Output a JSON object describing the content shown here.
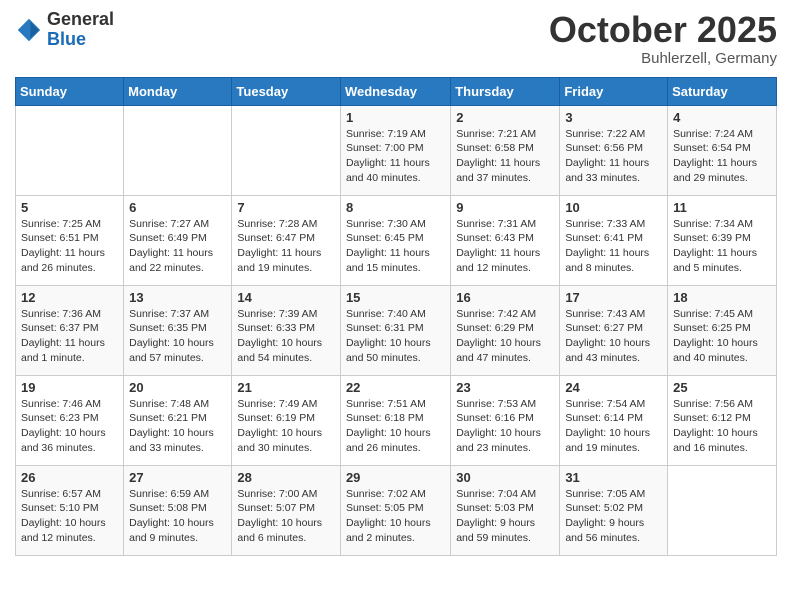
{
  "header": {
    "logo_general": "General",
    "logo_blue": "Blue",
    "month": "October 2025",
    "location": "Buhlerzell, Germany"
  },
  "days_of_week": [
    "Sunday",
    "Monday",
    "Tuesday",
    "Wednesday",
    "Thursday",
    "Friday",
    "Saturday"
  ],
  "weeks": [
    [
      {
        "day": "",
        "info": ""
      },
      {
        "day": "",
        "info": ""
      },
      {
        "day": "",
        "info": ""
      },
      {
        "day": "1",
        "info": "Sunrise: 7:19 AM\nSunset: 7:00 PM\nDaylight: 11 hours and 40 minutes."
      },
      {
        "day": "2",
        "info": "Sunrise: 7:21 AM\nSunset: 6:58 PM\nDaylight: 11 hours and 37 minutes."
      },
      {
        "day": "3",
        "info": "Sunrise: 7:22 AM\nSunset: 6:56 PM\nDaylight: 11 hours and 33 minutes."
      },
      {
        "day": "4",
        "info": "Sunrise: 7:24 AM\nSunset: 6:54 PM\nDaylight: 11 hours and 29 minutes."
      }
    ],
    [
      {
        "day": "5",
        "info": "Sunrise: 7:25 AM\nSunset: 6:51 PM\nDaylight: 11 hours and 26 minutes."
      },
      {
        "day": "6",
        "info": "Sunrise: 7:27 AM\nSunset: 6:49 PM\nDaylight: 11 hours and 22 minutes."
      },
      {
        "day": "7",
        "info": "Sunrise: 7:28 AM\nSunset: 6:47 PM\nDaylight: 11 hours and 19 minutes."
      },
      {
        "day": "8",
        "info": "Sunrise: 7:30 AM\nSunset: 6:45 PM\nDaylight: 11 hours and 15 minutes."
      },
      {
        "day": "9",
        "info": "Sunrise: 7:31 AM\nSunset: 6:43 PM\nDaylight: 11 hours and 12 minutes."
      },
      {
        "day": "10",
        "info": "Sunrise: 7:33 AM\nSunset: 6:41 PM\nDaylight: 11 hours and 8 minutes."
      },
      {
        "day": "11",
        "info": "Sunrise: 7:34 AM\nSunset: 6:39 PM\nDaylight: 11 hours and 5 minutes."
      }
    ],
    [
      {
        "day": "12",
        "info": "Sunrise: 7:36 AM\nSunset: 6:37 PM\nDaylight: 11 hours and 1 minute."
      },
      {
        "day": "13",
        "info": "Sunrise: 7:37 AM\nSunset: 6:35 PM\nDaylight: 10 hours and 57 minutes."
      },
      {
        "day": "14",
        "info": "Sunrise: 7:39 AM\nSunset: 6:33 PM\nDaylight: 10 hours and 54 minutes."
      },
      {
        "day": "15",
        "info": "Sunrise: 7:40 AM\nSunset: 6:31 PM\nDaylight: 10 hours and 50 minutes."
      },
      {
        "day": "16",
        "info": "Sunrise: 7:42 AM\nSunset: 6:29 PM\nDaylight: 10 hours and 47 minutes."
      },
      {
        "day": "17",
        "info": "Sunrise: 7:43 AM\nSunset: 6:27 PM\nDaylight: 10 hours and 43 minutes."
      },
      {
        "day": "18",
        "info": "Sunrise: 7:45 AM\nSunset: 6:25 PM\nDaylight: 10 hours and 40 minutes."
      }
    ],
    [
      {
        "day": "19",
        "info": "Sunrise: 7:46 AM\nSunset: 6:23 PM\nDaylight: 10 hours and 36 minutes."
      },
      {
        "day": "20",
        "info": "Sunrise: 7:48 AM\nSunset: 6:21 PM\nDaylight: 10 hours and 33 minutes."
      },
      {
        "day": "21",
        "info": "Sunrise: 7:49 AM\nSunset: 6:19 PM\nDaylight: 10 hours and 30 minutes."
      },
      {
        "day": "22",
        "info": "Sunrise: 7:51 AM\nSunset: 6:18 PM\nDaylight: 10 hours and 26 minutes."
      },
      {
        "day": "23",
        "info": "Sunrise: 7:53 AM\nSunset: 6:16 PM\nDaylight: 10 hours and 23 minutes."
      },
      {
        "day": "24",
        "info": "Sunrise: 7:54 AM\nSunset: 6:14 PM\nDaylight: 10 hours and 19 minutes."
      },
      {
        "day": "25",
        "info": "Sunrise: 7:56 AM\nSunset: 6:12 PM\nDaylight: 10 hours and 16 minutes."
      }
    ],
    [
      {
        "day": "26",
        "info": "Sunrise: 6:57 AM\nSunset: 5:10 PM\nDaylight: 10 hours and 12 minutes."
      },
      {
        "day": "27",
        "info": "Sunrise: 6:59 AM\nSunset: 5:08 PM\nDaylight: 10 hours and 9 minutes."
      },
      {
        "day": "28",
        "info": "Sunrise: 7:00 AM\nSunset: 5:07 PM\nDaylight: 10 hours and 6 minutes."
      },
      {
        "day": "29",
        "info": "Sunrise: 7:02 AM\nSunset: 5:05 PM\nDaylight: 10 hours and 2 minutes."
      },
      {
        "day": "30",
        "info": "Sunrise: 7:04 AM\nSunset: 5:03 PM\nDaylight: 9 hours and 59 minutes."
      },
      {
        "day": "31",
        "info": "Sunrise: 7:05 AM\nSunset: 5:02 PM\nDaylight: 9 hours and 56 minutes."
      },
      {
        "day": "",
        "info": ""
      }
    ]
  ]
}
